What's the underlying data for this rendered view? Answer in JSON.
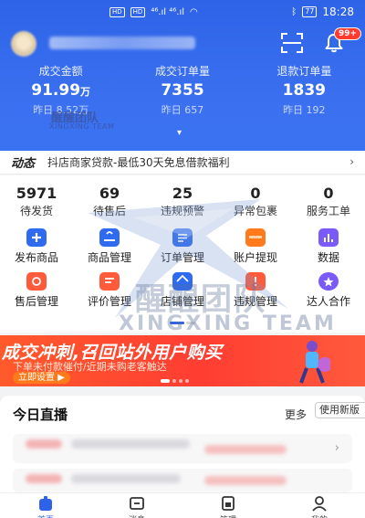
{
  "status_bar": {
    "sim1": "HD",
    "sim2": "HD",
    "signal": "⁴⁶.ıl ⁴⁶.ıl",
    "battery": "77",
    "time": "18:28"
  },
  "header": {
    "notification_badge": "99+"
  },
  "stats": [
    {
      "label": "成交金额",
      "value": "91.99",
      "unit": "万",
      "sub": "昨日 8.52万"
    },
    {
      "label": "成交订单量",
      "value": "7355",
      "unit": "",
      "sub": "昨日 657"
    },
    {
      "label": "退款订单量",
      "value": "1839",
      "unit": "",
      "sub": "昨日 192"
    }
  ],
  "news": {
    "tag": "动态",
    "text": "抖店商家贷款-最低30天免息借款福利",
    "arrow": "›"
  },
  "counts": [
    {
      "num": "5971",
      "label": "待发货"
    },
    {
      "num": "69",
      "label": "待售后"
    },
    {
      "num": "25",
      "label": "违规预警"
    },
    {
      "num": "0",
      "label": "异常包裹"
    },
    {
      "num": "0",
      "label": "服务工单"
    }
  ],
  "tools": [
    {
      "label": "发布商品",
      "icon": "plus-icon",
      "color": "#2f6bf0"
    },
    {
      "label": "商品管理",
      "icon": "bag-icon",
      "color": "#2f6bf0"
    },
    {
      "label": "订单管理",
      "icon": "list-icon",
      "color": "#2f6bf0"
    },
    {
      "label": "账户提现",
      "icon": "wallet-icon",
      "color": "#ff7a1a"
    },
    {
      "label": "数据",
      "icon": "chart-icon",
      "color": "#7a5af8"
    },
    {
      "label": "售后管理",
      "icon": "service-icon",
      "color": "#ff5a3c"
    },
    {
      "label": "评价管理",
      "icon": "comment-icon",
      "color": "#ff5a3c"
    },
    {
      "label": "店铺管理",
      "icon": "shop-icon",
      "color": "#2f6bf0"
    },
    {
      "label": "违规管理",
      "icon": "warning-icon",
      "color": "#ff5a3c"
    },
    {
      "label": "达人合作",
      "icon": "star-icon",
      "color": "#7a5af8"
    }
  ],
  "banner": {
    "title": "成交冲刺,召回站外用户购买",
    "subtitle": "下单未付款催付/近期未购老客触达",
    "button": "立即设置 ▶"
  },
  "live": {
    "title": "今日直播",
    "more": "更多",
    "new_version": "使用新版"
  },
  "watermark": {
    "cn_small": "醒醒团队",
    "en_small": "XINGXING TEAM",
    "cn_big": "醒醒团队",
    "en_big": "XINGXING TEAM"
  },
  "nav": [
    {
      "label": "首页",
      "icon": "home-icon",
      "active": true
    },
    {
      "label": "消息",
      "icon": "message-icon",
      "active": false
    },
    {
      "label": "管理",
      "icon": "manage-icon",
      "active": false
    },
    {
      "label": "我的",
      "icon": "profile-icon",
      "active": false
    }
  ]
}
